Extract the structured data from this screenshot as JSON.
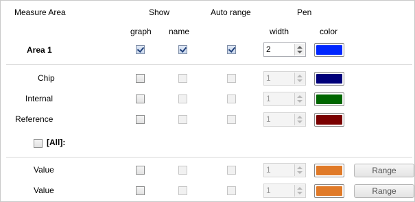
{
  "header": {
    "measure_area": "Measure Area",
    "show": "Show",
    "auto_range": "Auto range",
    "pen": "Pen",
    "graph": "graph",
    "name": "name",
    "width": "width",
    "color": "color"
  },
  "area1": {
    "label": "Area 1",
    "graph_checked": true,
    "name_checked": true,
    "auto_checked": true,
    "width": "2",
    "color": "#0026ff"
  },
  "rows": [
    {
      "label": "Chip",
      "width": "1",
      "color": "#00007a"
    },
    {
      "label": "Internal",
      "width": "1",
      "color": "#006600"
    },
    {
      "label": "Reference",
      "width": "1",
      "color": "#7a0000"
    }
  ],
  "all_label": "[All]:",
  "value_rows": [
    {
      "label": "Value",
      "width": "1",
      "color": "#e07a28",
      "button": "Range"
    },
    {
      "label": "Value",
      "width": "1",
      "color": "#e07a28",
      "button": "Range"
    }
  ]
}
